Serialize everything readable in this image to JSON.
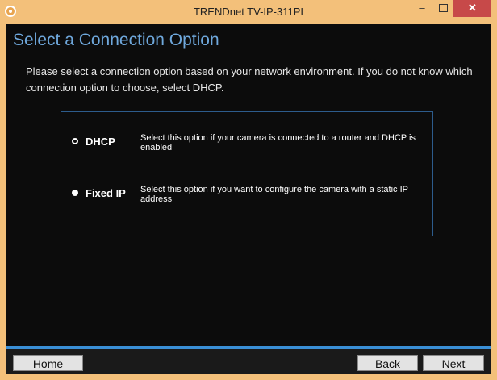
{
  "window": {
    "title": "TRENDnet TV-IP-311PI",
    "minimize_glyph": "–",
    "close_glyph": "✕"
  },
  "page": {
    "heading": "Select a Connection Option",
    "intro": "Please select a connection option based on your network environment. If you do not know which connection option to choose, select DHCP."
  },
  "options": [
    {
      "label": "DHCP",
      "description": "Select this option if your camera is connected to a router and DHCP is enabled",
      "selected": true
    },
    {
      "label": "Fixed IP",
      "description": "Select this option if you want to configure the camera with a static IP address",
      "selected": false
    }
  ],
  "buttons": {
    "home": "Home",
    "back": "Back",
    "next": "Next"
  },
  "colors": {
    "titlebar": "#f3c07a",
    "close_button": "#c74949",
    "heading": "#6fa8dc",
    "accent": "#3a8fd6",
    "content_bg": "#0c0c0c"
  },
  "icons": {
    "app": "app-icon",
    "minimize": "minimize-icon",
    "maximize": "maximize-icon",
    "close": "close-icon"
  }
}
